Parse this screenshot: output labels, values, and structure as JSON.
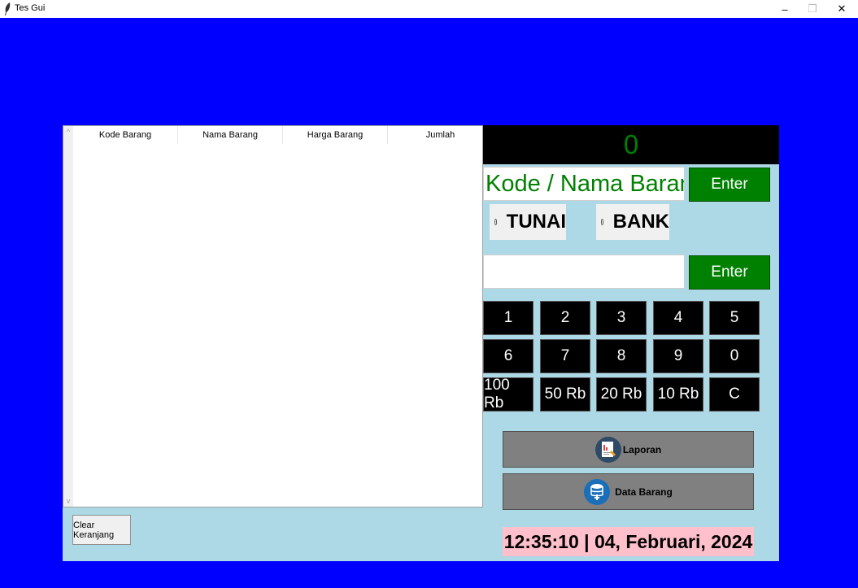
{
  "window": {
    "title": "Tes Gui",
    "minimize": "–",
    "maximize": "❐",
    "close": "✕"
  },
  "table": {
    "columns": [
      "Kode Barang",
      "Nama Barang",
      "Harga Barang",
      "Jumlah"
    ]
  },
  "clear_button": "Clear Keranjang",
  "total_display": "0",
  "search": {
    "placeholder": "Kode / Nama Barang",
    "enter_label": "Enter"
  },
  "payment": {
    "options": [
      "TUNAI",
      "BANK"
    ],
    "enter_label": "Enter"
  },
  "keypad": {
    "row1": [
      "1",
      "2",
      "3",
      "4",
      "5"
    ],
    "row2": [
      "6",
      "7",
      "8",
      "9",
      "0"
    ],
    "row3": [
      "100 Rb",
      "50 Rb",
      "20 Rb",
      "10 Rb",
      "C"
    ]
  },
  "actions": {
    "laporan": "Laporan",
    "data_barang": "Data Barang"
  },
  "clock": "12:35:10 | 04, Februari, 2024",
  "colors": {
    "background": "#0000ff",
    "panel": "#add8e6",
    "green": "#008000",
    "clock_bg": "#ffc0cb"
  }
}
